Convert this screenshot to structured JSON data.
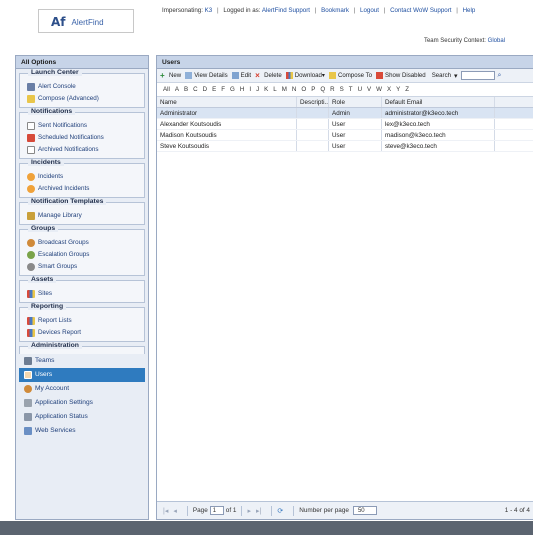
{
  "header": {
    "logo_mark": "Af",
    "logo_text": "AlertFind",
    "impersonating_label": "Impersonating:",
    "impersonating_value": "K3",
    "logged_in_label": "Logged in as:",
    "logged_in_value": "AlertFind Support",
    "bookmark": "Bookmark",
    "logout": "Logout",
    "contact": "Contact WoW Support",
    "help": "Help",
    "team_context_label": "Team Security Context:",
    "team_context_value": "Global"
  },
  "sidebar": {
    "title": "All Options",
    "groups": [
      {
        "legend": "Launch Center",
        "items": [
          "Alert Console",
          "Compose (Advanced)"
        ]
      },
      {
        "legend": "Notifications",
        "items": [
          "Sent Notifications",
          "Scheduled Notifications",
          "Archived Notifications"
        ]
      },
      {
        "legend": "Incidents",
        "items": [
          "Incidents",
          "Archived Incidents"
        ]
      },
      {
        "legend": "Notification Templates",
        "items": [
          "Manage Library"
        ]
      },
      {
        "legend": "Groups",
        "items": [
          "Broadcast Groups",
          "Escalation Groups",
          "Smart Groups"
        ]
      },
      {
        "legend": "Assets",
        "items": [
          "Sites"
        ]
      },
      {
        "legend": "Reporting",
        "items": [
          "Report Lists",
          "Devices Report"
        ]
      },
      {
        "legend": "Administration",
        "items": [
          "Teams",
          "Users",
          "My Account",
          "Application Settings",
          "Application Status",
          "Web Services"
        ]
      }
    ]
  },
  "main": {
    "title": "Users",
    "toolbar": {
      "new": "New",
      "view_details": "View Details",
      "edit": "Edit",
      "delete": "Delete",
      "download": "Download",
      "compose_to": "Compose To",
      "show_disabled": "Show Disabled",
      "search": "Search"
    },
    "alphabet": [
      "All",
      "A",
      "B",
      "C",
      "D",
      "E",
      "F",
      "G",
      "H",
      "I",
      "J",
      "K",
      "L",
      "M",
      "N",
      "O",
      "P",
      "Q",
      "R",
      "S",
      "T",
      "U",
      "V",
      "W",
      "X",
      "Y",
      "Z"
    ],
    "columns": {
      "name": "Name",
      "desc": "Descripti...",
      "role": "Role",
      "email": "Default Email"
    },
    "rows": [
      {
        "name": "Administrator",
        "desc": "",
        "role": "Admin",
        "email": "administrator@k3eco.tech"
      },
      {
        "name": "Alexander Koutsoudis",
        "desc": "",
        "role": "User",
        "email": "lex@k3eco.tech"
      },
      {
        "name": "Madison Koutsoudis",
        "desc": "",
        "role": "User",
        "email": "madison@k3eco.tech"
      },
      {
        "name": "Steve Koutsoudis",
        "desc": "",
        "role": "User",
        "email": "steve@k3eco.tech"
      }
    ],
    "pager": {
      "page_label": "Page",
      "page_value": "1",
      "of_label": "of 1",
      "per_page_label": "Number per page",
      "per_page_value": "50",
      "range": "1 - 4 of 4"
    }
  },
  "colors": {
    "accent": "#2f7bbf",
    "panel_header": "#c7d4e8",
    "link": "#1f4fa0"
  }
}
